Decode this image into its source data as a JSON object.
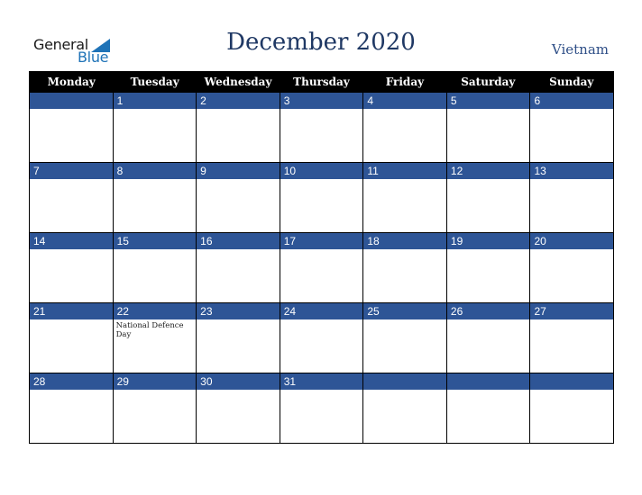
{
  "logo": {
    "line1": "General",
    "line2": "Blue"
  },
  "title": "December 2020",
  "country": "Vietnam",
  "weekdays": [
    "Monday",
    "Tuesday",
    "Wednesday",
    "Thursday",
    "Friday",
    "Saturday",
    "Sunday"
  ],
  "weeks": [
    [
      {
        "d": ""
      },
      {
        "d": "1"
      },
      {
        "d": "2"
      },
      {
        "d": "3"
      },
      {
        "d": "4"
      },
      {
        "d": "5"
      },
      {
        "d": "6"
      }
    ],
    [
      {
        "d": "7"
      },
      {
        "d": "8"
      },
      {
        "d": "9"
      },
      {
        "d": "10"
      },
      {
        "d": "11"
      },
      {
        "d": "12"
      },
      {
        "d": "13"
      }
    ],
    [
      {
        "d": "14"
      },
      {
        "d": "15"
      },
      {
        "d": "16"
      },
      {
        "d": "17"
      },
      {
        "d": "18"
      },
      {
        "d": "19"
      },
      {
        "d": "20"
      }
    ],
    [
      {
        "d": "21"
      },
      {
        "d": "22",
        "event": "National Defence Day"
      },
      {
        "d": "23"
      },
      {
        "d": "24"
      },
      {
        "d": "25"
      },
      {
        "d": "26"
      },
      {
        "d": "27"
      }
    ],
    [
      {
        "d": "28"
      },
      {
        "d": "29"
      },
      {
        "d": "30"
      },
      {
        "d": "31"
      },
      {
        "d": ""
      },
      {
        "d": ""
      },
      {
        "d": ""
      }
    ]
  ],
  "colors": {
    "header_bg": "#000000",
    "date_bar": "#2e5596",
    "title": "#1f3864",
    "logo_blue": "#1f73b7"
  }
}
